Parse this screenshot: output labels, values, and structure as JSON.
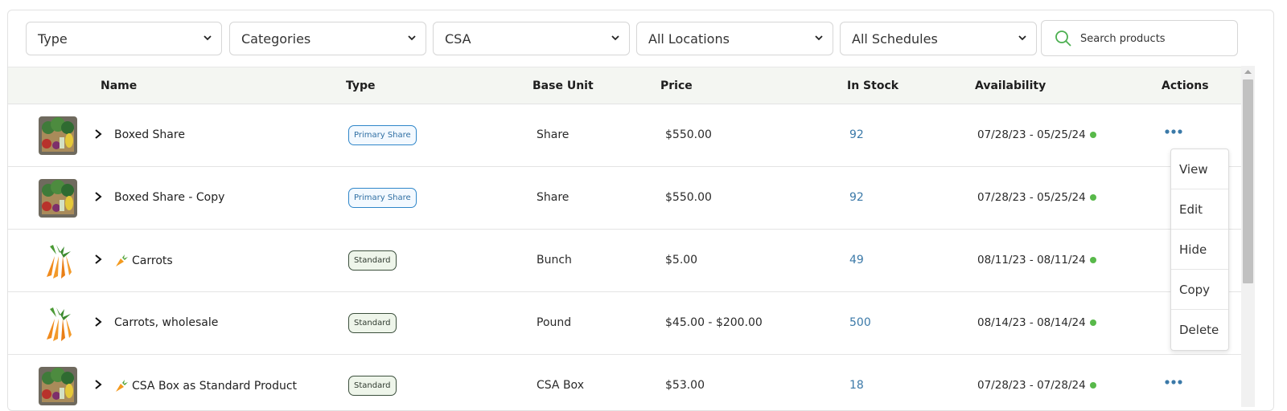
{
  "filters": {
    "type": "Type",
    "categories": "Categories",
    "csa": "CSA",
    "locations": "All Locations",
    "schedules": "All Schedules",
    "search_placeholder": "Search products"
  },
  "columns": {
    "name": "Name",
    "type": "Type",
    "base_unit": "Base Unit",
    "price": "Price",
    "in_stock": "In Stock",
    "availability": "Availability",
    "actions": "Actions"
  },
  "rows": [
    {
      "name": "Boxed Share",
      "type": "Primary Share",
      "unit": "Share",
      "price": "$550.00",
      "stock": "92",
      "availability": "07/28/23 - 05/25/24",
      "thumb": "box-icon",
      "carrot": false
    },
    {
      "name": "Boxed Share - Copy",
      "type": "Primary Share",
      "unit": "Share",
      "price": "$550.00",
      "stock": "92",
      "availability": "07/28/23 - 05/25/24",
      "thumb": "box-icon",
      "carrot": false
    },
    {
      "name": "Carrots",
      "type": "Standard",
      "unit": "Bunch",
      "price": "$5.00",
      "stock": "49",
      "availability": "08/11/23 - 08/11/24",
      "thumb": "carrot-icon",
      "carrot": true
    },
    {
      "name": "Carrots, wholesale",
      "type": "Standard",
      "unit": "Pound",
      "price": "$45.00 - $200.00",
      "stock": "500",
      "availability": "08/14/23 - 08/14/24",
      "thumb": "carrot-icon",
      "carrot": false
    },
    {
      "name": "CSA Box as Standard Product",
      "type": "Standard",
      "unit": "CSA Box",
      "price": "$53.00",
      "stock": "18",
      "availability": "07/28/23 - 07/28/24",
      "thumb": "box-icon",
      "carrot": true
    }
  ],
  "action_menu": [
    "View",
    "Edit",
    "Hide",
    "Copy",
    "Delete"
  ],
  "colors": {
    "accent": "#3b79a8",
    "available_dot": "#58b94a",
    "header_bg": "#f4f6f2",
    "search_icon": "#4caf50"
  }
}
